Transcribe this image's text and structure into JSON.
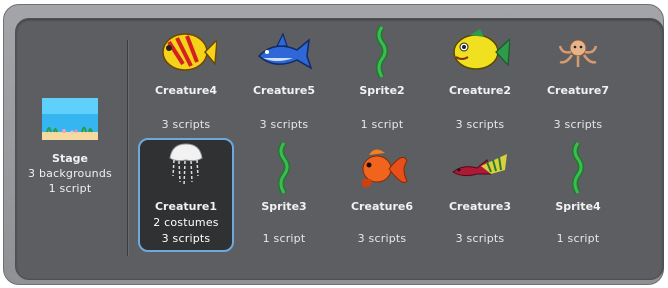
{
  "stage": {
    "name": "Stage",
    "backgrounds": "3 backgrounds",
    "scripts": "1 script"
  },
  "sprites": [
    {
      "name": "Creature4",
      "info": "3 scripts",
      "icon": "yellow-fish-icon"
    },
    {
      "name": "Creature5",
      "info": "3 scripts",
      "icon": "blue-shark-icon"
    },
    {
      "name": "Sprite2",
      "info": "1 script",
      "icon": "seaweed-icon"
    },
    {
      "name": "Creature2",
      "info": "3 scripts",
      "icon": "yellow-fish-icon"
    },
    {
      "name": "Creature7",
      "info": "3 scripts",
      "icon": "octopus-icon"
    },
    {
      "name": "Creature1",
      "costumes": "2 costumes",
      "info": "3 scripts",
      "icon": "jellyfish-icon",
      "selected": true
    },
    {
      "name": "Sprite3",
      "info": "1 script",
      "icon": "seaweed-icon"
    },
    {
      "name": "Creature6",
      "info": "3 scripts",
      "icon": "goldfish-icon"
    },
    {
      "name": "Creature3",
      "info": "3 scripts",
      "icon": "striped-fish-icon"
    },
    {
      "name": "Sprite4",
      "info": "1 script",
      "icon": "seaweed-icon"
    }
  ],
  "colors": {
    "panel_bg": "#5c5e61",
    "frame": "#9a9c9f",
    "selected_bg": "#303133",
    "selected_border": "#6fa8dc"
  }
}
